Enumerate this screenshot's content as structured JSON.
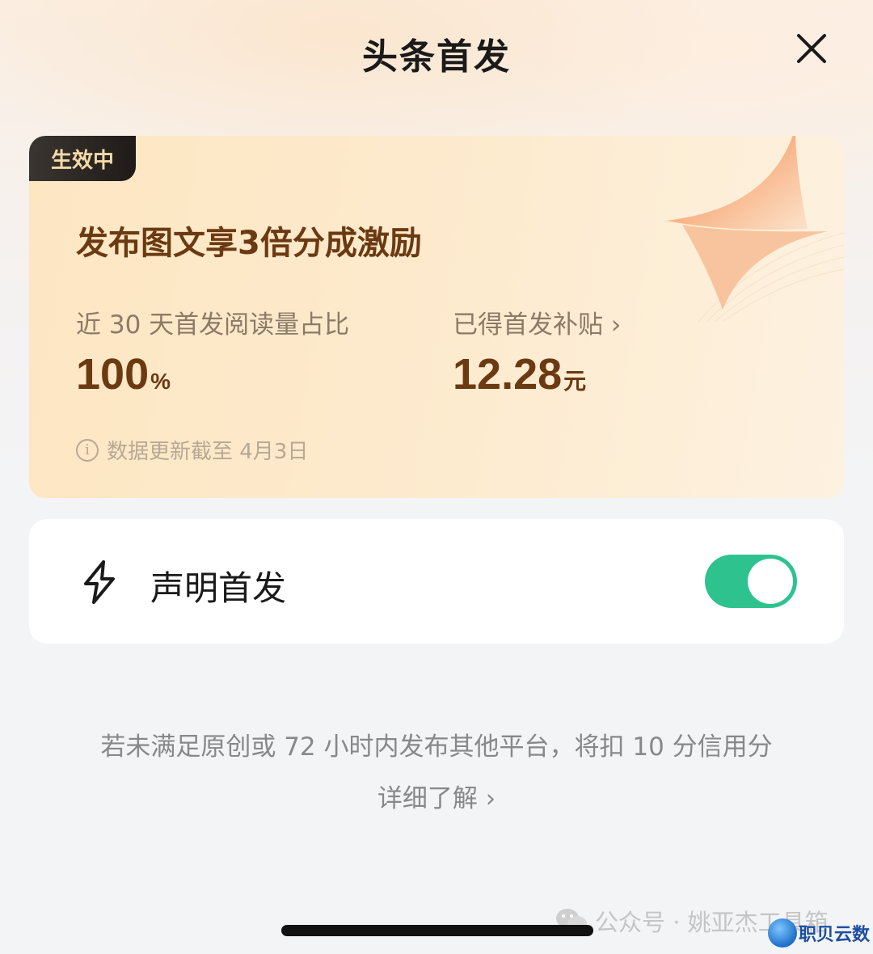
{
  "header": {
    "title": "头条首发"
  },
  "card": {
    "badge": "生效中",
    "title": "发布图文享3倍分成激励",
    "stat1": {
      "label": "近 30 天首发阅读量占比",
      "value": "100",
      "unit": "%"
    },
    "stat2": {
      "label": "已得首发补贴 ›",
      "value": "12.28",
      "unit": "元"
    },
    "note": "数据更新截至 4月3日"
  },
  "toggle": {
    "label": "声明首发",
    "on": true,
    "color": "#2ec28f"
  },
  "footer": {
    "warning": "若未满足原创或 72 小时内发布其他平台，将扣 10 分信用分",
    "more_link": "详细了解 ›"
  },
  "watermark": {
    "text": "公众号 · 姚亚杰工具箱"
  },
  "corner_logo": {
    "text": "职贝云数"
  },
  "icons": [
    "close-icon",
    "info-icon",
    "lightning-icon",
    "wechat-icon"
  ]
}
